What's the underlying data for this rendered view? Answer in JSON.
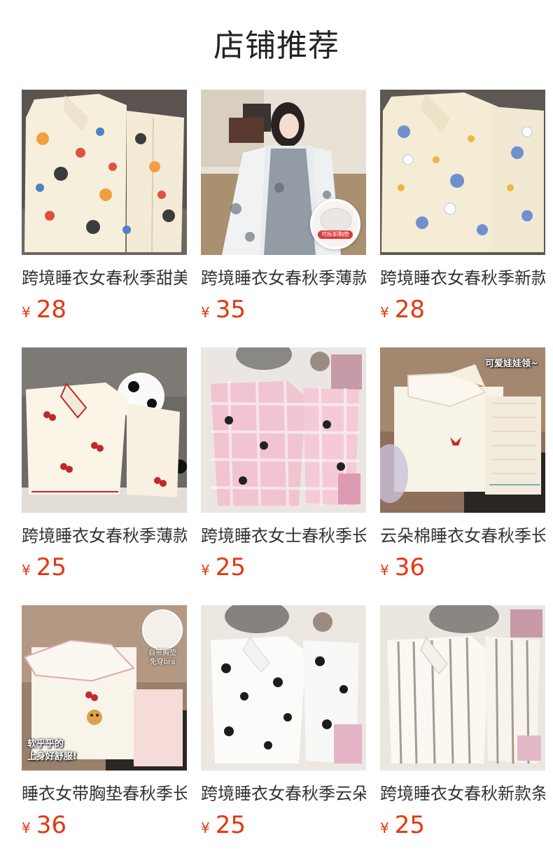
{
  "header": {
    "title": "店铺推荐"
  },
  "products": [
    {
      "name": "跨境睡衣女春秋季甜美",
      "currency": "¥",
      "price": "28",
      "image": "cream-cartoon-pajama-set"
    },
    {
      "name": "跨境睡衣女春秋季薄款",
      "currency": "¥",
      "price": "35",
      "image": "model-toile-print-robe-set",
      "badge": "可拆卸胸垫"
    },
    {
      "name": "跨境睡衣女春秋季新款",
      "currency": "¥",
      "price": "28",
      "image": "cream-blue-cartoon-pajama-set"
    },
    {
      "name": "跨境睡衣女春秋季薄款",
      "currency": "¥",
      "price": "25",
      "image": "cherry-print-pajama-set"
    },
    {
      "name": "跨境睡衣女士春秋季长",
      "currency": "¥",
      "price": "25",
      "image": "pink-gingham-cat-pajama-set"
    },
    {
      "name": "云朵棉睡衣女春秋季长",
      "currency": "¥",
      "price": "36",
      "image": "cream-bow-collar-pajama-set",
      "overlay": "可爱娃娃领~"
    },
    {
      "name": "睡衣女带胸垫春秋季长",
      "currency": "¥",
      "price": "36",
      "image": "cream-bear-collar-pajama-set",
      "overlay_lines": [
        "软乎乎的",
        "上身好舒服!"
      ],
      "corner_lines": [
        "自带胸垫",
        "免穿bra"
      ]
    },
    {
      "name": "跨境睡衣女春秋季云朵",
      "currency": "¥",
      "price": "25",
      "image": "white-black-cat-pajama-set"
    },
    {
      "name": "跨境睡衣女春秋新款条",
      "currency": "¥",
      "price": "25",
      "image": "striped-pajama-set"
    }
  ],
  "colors": {
    "price": "#e4380d",
    "title": "#222222",
    "text": "#333333"
  }
}
